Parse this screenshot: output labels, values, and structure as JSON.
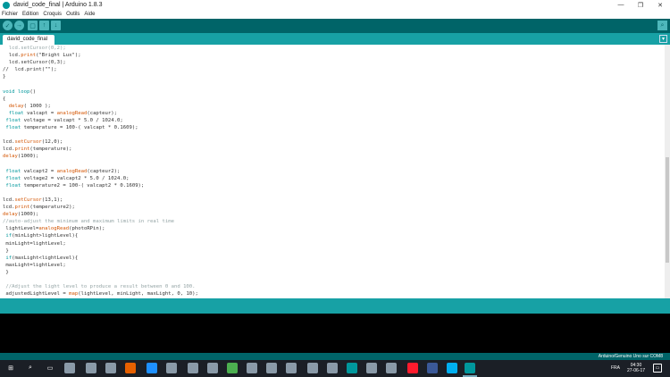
{
  "window": {
    "title": "david_code_final | Arduino 1.8.3",
    "controls": [
      "—",
      "❐",
      "✕"
    ]
  },
  "menu": [
    "Fichier",
    "Edition",
    "Croquis",
    "Outils",
    "Aide"
  ],
  "toolbar": {
    "verify_icon": "✓",
    "upload_icon": "→",
    "new_icon": "▢",
    "open_icon": "↑",
    "save_icon": "↓",
    "serial_monitor_icon": "⌕"
  },
  "tabs": [
    {
      "label": "david_code_final"
    }
  ],
  "tab_menu_icon": "▾",
  "editor": {
    "lines": [
      [
        {
          "t": "  ",
          "c": ""
        },
        {
          "t": "lcd.setCursor(0,2);",
          "c": "cm"
        }
      ],
      [
        {
          "t": "  lcd.",
          "c": ""
        },
        {
          "t": "print",
          "c": "fn"
        },
        {
          "t": "(\"Bright Lux\");",
          "c": ""
        }
      ],
      [
        {
          "t": "  lcd.setCursor(0,3);",
          "c": ""
        }
      ],
      [
        {
          "t": "//  lcd.print(\"\");",
          "c": ""
        }
      ],
      [
        {
          "t": "}",
          "c": ""
        }
      ],
      [
        {
          "t": "",
          "c": ""
        }
      ],
      [
        {
          "t": "void",
          "c": "kw"
        },
        {
          "t": " ",
          "c": ""
        },
        {
          "t": "loop",
          "c": "kw"
        },
        {
          "t": "()",
          "c": ""
        }
      ],
      [
        {
          "t": "{",
          "c": ""
        }
      ],
      [
        {
          "t": "  ",
          "c": ""
        },
        {
          "t": "delay",
          "c": "fn"
        },
        {
          "t": "( 1000 );",
          "c": ""
        }
      ],
      [
        {
          "t": "  ",
          "c": ""
        },
        {
          "t": "float",
          "c": "kw"
        },
        {
          "t": " valcapt = ",
          "c": ""
        },
        {
          "t": "analogRead",
          "c": "fn"
        },
        {
          "t": "(capteur);",
          "c": ""
        }
      ],
      [
        {
          "t": " ",
          "c": ""
        },
        {
          "t": "float",
          "c": "kw"
        },
        {
          "t": " voltage = valcapt * 5.0 / 1024.0;",
          "c": ""
        }
      ],
      [
        {
          "t": " ",
          "c": ""
        },
        {
          "t": "float",
          "c": "kw"
        },
        {
          "t": " temperature = 100-( valcapt * 0.1609);",
          "c": ""
        }
      ],
      [
        {
          "t": "",
          "c": ""
        }
      ],
      [
        {
          "t": "lcd.",
          "c": ""
        },
        {
          "t": "setCursor",
          "c": "fn"
        },
        {
          "t": "(12,0);",
          "c": ""
        }
      ],
      [
        {
          "t": "lcd.",
          "c": ""
        },
        {
          "t": "print",
          "c": "fn"
        },
        {
          "t": "(temperature);",
          "c": ""
        }
      ],
      [
        {
          "t": "delay",
          "c": "fn"
        },
        {
          "t": "(1000);",
          "c": ""
        }
      ],
      [
        {
          "t": "",
          "c": ""
        }
      ],
      [
        {
          "t": " ",
          "c": ""
        },
        {
          "t": "float",
          "c": "kw"
        },
        {
          "t": " valcapt2 = ",
          "c": ""
        },
        {
          "t": "analogRead",
          "c": "fn"
        },
        {
          "t": "(capteur2);",
          "c": ""
        }
      ],
      [
        {
          "t": " ",
          "c": ""
        },
        {
          "t": "float",
          "c": "kw"
        },
        {
          "t": " voltage2 = valcapt2 * 5.0 / 1024.0;",
          "c": ""
        }
      ],
      [
        {
          "t": " ",
          "c": ""
        },
        {
          "t": "float",
          "c": "kw"
        },
        {
          "t": " temperature2 = 100-( valcapt2 * 0.1609);",
          "c": ""
        }
      ],
      [
        {
          "t": "",
          "c": ""
        }
      ],
      [
        {
          "t": "lcd.",
          "c": ""
        },
        {
          "t": "setCursor",
          "c": "fn"
        },
        {
          "t": "(13,1);",
          "c": ""
        }
      ],
      [
        {
          "t": "lcd.",
          "c": ""
        },
        {
          "t": "print",
          "c": "fn"
        },
        {
          "t": "(temperature2);",
          "c": ""
        }
      ],
      [
        {
          "t": "delay",
          "c": "fn"
        },
        {
          "t": "(1000);",
          "c": ""
        }
      ],
      [
        {
          "t": "//auto-adjust the minimum and maximum limits in real time",
          "c": "cm"
        }
      ],
      [
        {
          "t": " lightLevel=",
          "c": ""
        },
        {
          "t": "analogRead",
          "c": "fn"
        },
        {
          "t": "(photoRPin);",
          "c": ""
        }
      ],
      [
        {
          "t": " ",
          "c": ""
        },
        {
          "t": "if",
          "c": "kw"
        },
        {
          "t": "(minLight>lightLevel){",
          "c": ""
        }
      ],
      [
        {
          "t": " minLight=lightLevel;",
          "c": ""
        }
      ],
      [
        {
          "t": " }",
          "c": ""
        }
      ],
      [
        {
          "t": " ",
          "c": ""
        },
        {
          "t": "if",
          "c": "kw"
        },
        {
          "t": "(maxLight<lightLevel){",
          "c": ""
        }
      ],
      [
        {
          "t": " maxLight=lightLevel;",
          "c": ""
        }
      ],
      [
        {
          "t": " }",
          "c": ""
        }
      ],
      [
        {
          "t": "",
          "c": ""
        }
      ],
      [
        {
          "t": " //Adjust the light level to produce a result between 0 and 100.",
          "c": "cm"
        }
      ],
      [
        {
          "t": " adjustedLightLevel = ",
          "c": ""
        },
        {
          "t": "map",
          "c": "fn"
        },
        {
          "t": "(lightLevel, minLight, maxLight, 0, 10);",
          "c": ""
        }
      ]
    ]
  },
  "status": {
    "board": "Arduino/Genuino Uno sur COM8"
  },
  "taskbar": {
    "icons": [
      "start-icon",
      "search-icon",
      "task-view-icon",
      "app-icon",
      "app-icon",
      "app-icon",
      "firefox-icon",
      "edge-icon",
      "app-icon",
      "app-icon",
      "app-icon",
      "chrome-icon",
      "app-icon",
      "app-icon",
      "app-icon",
      "app-icon",
      "app-icon",
      "arduino-icon",
      "app-icon",
      "app-icon",
      "opera-icon",
      "facebook-icon",
      "skype-icon",
      "arduino-icon"
    ],
    "language": "FRA",
    "time": "04:30",
    "date": "27-06-17"
  }
}
